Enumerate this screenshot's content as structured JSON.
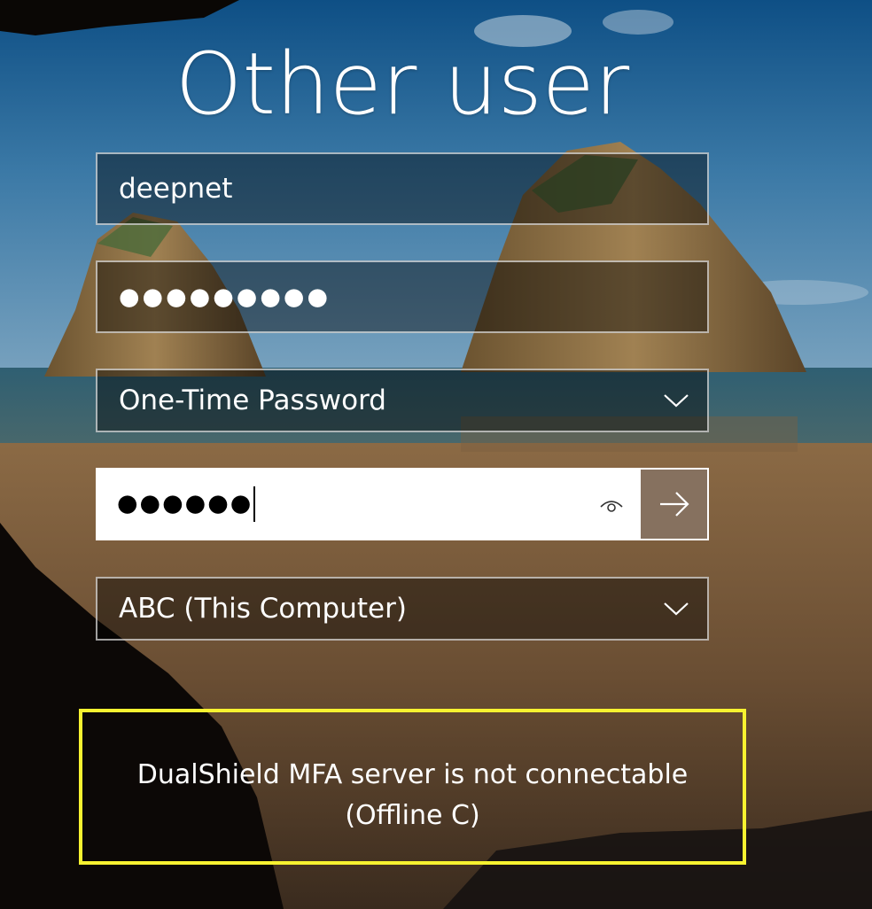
{
  "login": {
    "title": "Other user",
    "username_value": "deepnet",
    "password_masked": "●●●●●●●●●",
    "otp_method": "One-Time Password",
    "otp_code_masked": "●●●●●●",
    "sign_in_to": "ABC (This Computer)"
  },
  "status": {
    "line1": "DualShield MFA server is not connectable",
    "line2": "(Offline C)"
  },
  "icons": {
    "otp_select": "chevron-down-icon",
    "domain_select": "chevron-down-icon",
    "reveal": "eye-icon",
    "submit": "arrow-right-icon"
  },
  "colors": {
    "status_border": "#f7f230",
    "submit_button": "#86715f",
    "field_border": "#ffffff"
  }
}
